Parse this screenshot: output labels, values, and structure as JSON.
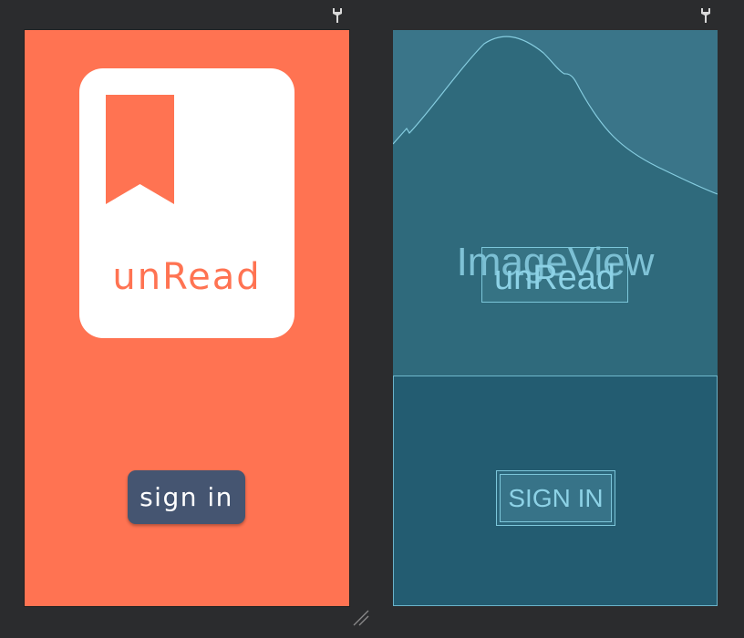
{
  "design": {
    "logo_text": "unRead",
    "signin_label": "sign in"
  },
  "blueprint": {
    "image_label": "ImageView",
    "logo_text": "unRead",
    "signin_label": "SIGN IN"
  },
  "icons": [
    "pin-icon",
    "bookmark-icon",
    "resize-handle-icon"
  ],
  "colors": {
    "design_background": "#ff7352",
    "card": "#ffffff",
    "button": "#455571",
    "blueprint_background": "#235c71",
    "blueprint_image": "#2f6a7c",
    "blueprint_line": "#7cc6da"
  }
}
